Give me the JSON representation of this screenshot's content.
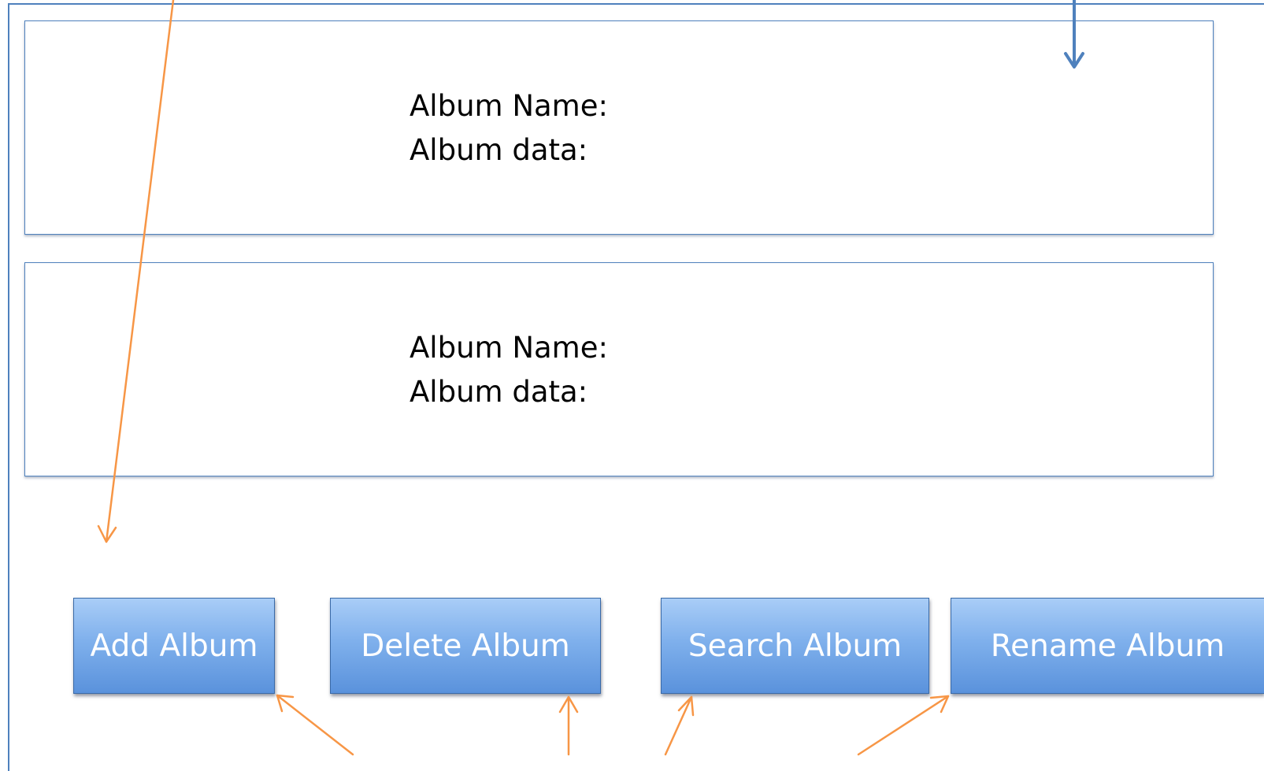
{
  "albums": [
    {
      "name_label": "Album Name:",
      "data_label": "Album data:"
    },
    {
      "name_label": "Album Name:",
      "data_label": "Album data:"
    }
  ],
  "buttons": {
    "add": "Add Album",
    "delete": "Delete Album",
    "search": "Search Album",
    "rename": "Rename Album"
  },
  "colors": {
    "frame_border": "#4f81bd",
    "button_top": "#a9cdf7",
    "button_bottom": "#5a92dc",
    "annotation_arrow": "#f79646",
    "blue_arrow": "#4f81bd"
  }
}
